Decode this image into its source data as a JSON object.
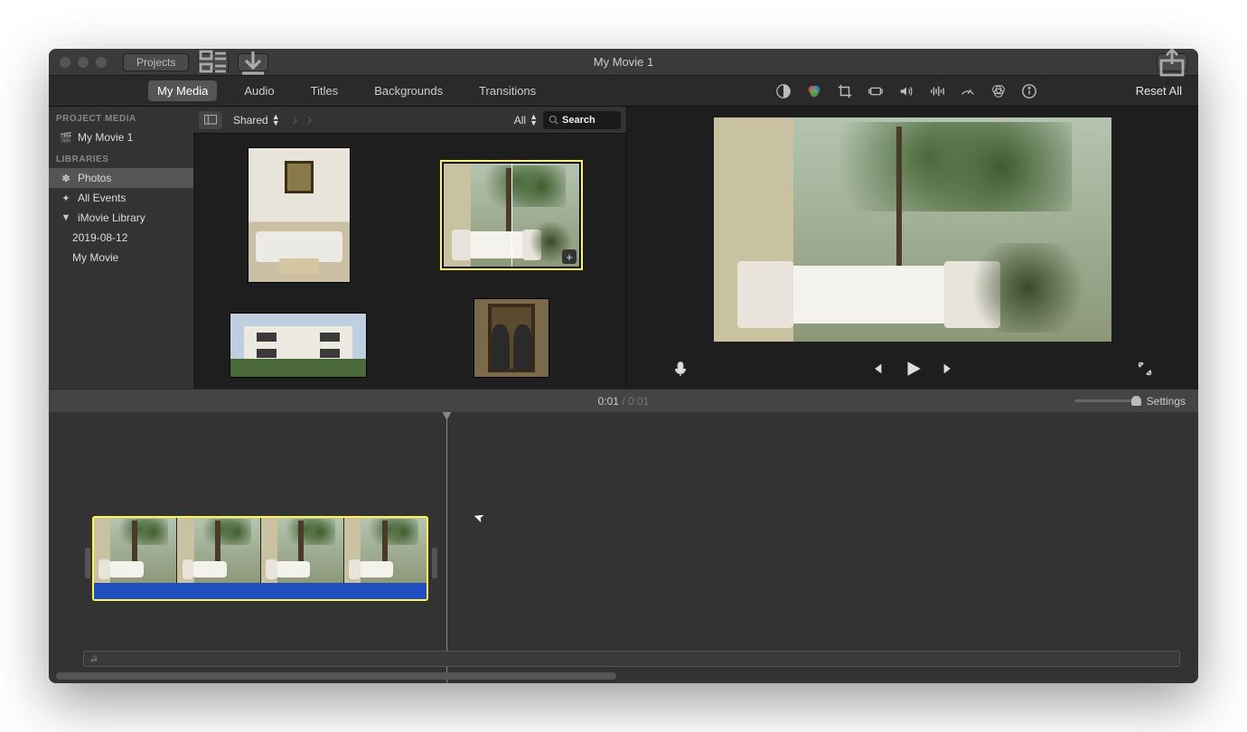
{
  "titlebar": {
    "projects_label": "Projects",
    "title": "My Movie 1"
  },
  "tabs": {
    "my_media": "My Media",
    "audio": "Audio",
    "titles": "Titles",
    "backgrounds": "Backgrounds",
    "transitions": "Transitions"
  },
  "adjust": {
    "reset_label": "Reset All"
  },
  "sidebar": {
    "project_media_head": "PROJECT MEDIA",
    "movie_name": "My Movie 1",
    "libraries_head": "LIBRARIES",
    "photos": "Photos",
    "all_events": "All Events",
    "imovie_library": "iMovie Library",
    "event_date": "2019-08-12",
    "my_movie": "My Movie"
  },
  "browser_bar": {
    "shared_label": "Shared",
    "filter_label": "All",
    "search_placeholder": "Search"
  },
  "time": {
    "current": "0:01",
    "total": "0:01",
    "settings_label": "Settings"
  }
}
